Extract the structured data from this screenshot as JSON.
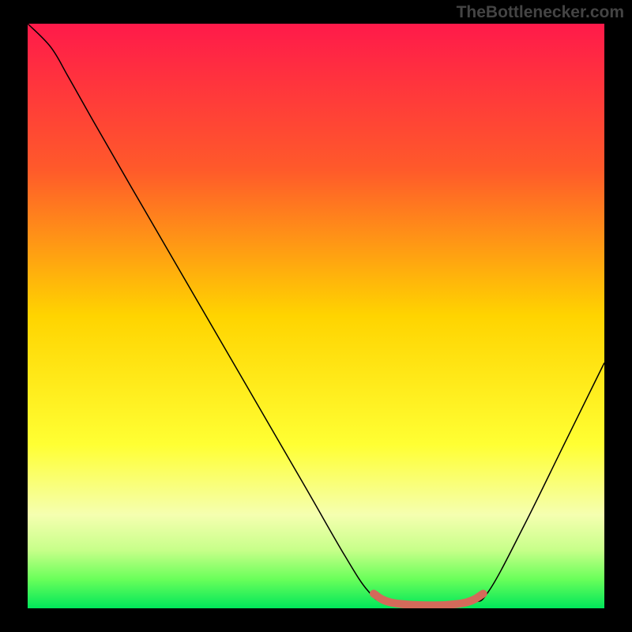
{
  "watermark": "TheBottlenecker.com",
  "chart_data": {
    "type": "line",
    "title": "",
    "xlabel": "",
    "ylabel": "",
    "xlim": [
      0,
      100
    ],
    "ylim": [
      0,
      100
    ],
    "grid": false,
    "gradient_stops": [
      {
        "offset": 0,
        "color": "#ff1a4a"
      },
      {
        "offset": 25,
        "color": "#ff5a2a"
      },
      {
        "offset": 50,
        "color": "#ffd400"
      },
      {
        "offset": 72,
        "color": "#ffff33"
      },
      {
        "offset": 84,
        "color": "#f5ffb0"
      },
      {
        "offset": 90,
        "color": "#c8ff8a"
      },
      {
        "offset": 95,
        "color": "#6aff5a"
      },
      {
        "offset": 100,
        "color": "#00e65a"
      }
    ],
    "series": [
      {
        "name": "bottleneck-curve",
        "color": "#000000",
        "points": [
          {
            "x": 0,
            "y": 100
          },
          {
            "x": 4,
            "y": 96
          },
          {
            "x": 7,
            "y": 91
          },
          {
            "x": 11,
            "y": 84
          },
          {
            "x": 18,
            "y": 72
          },
          {
            "x": 28,
            "y": 55
          },
          {
            "x": 38,
            "y": 38
          },
          {
            "x": 48,
            "y": 21
          },
          {
            "x": 55,
            "y": 9
          },
          {
            "x": 59,
            "y": 3
          },
          {
            "x": 62,
            "y": 1
          },
          {
            "x": 70,
            "y": 0.5
          },
          {
            "x": 77,
            "y": 1
          },
          {
            "x": 80,
            "y": 3
          },
          {
            "x": 86,
            "y": 14
          },
          {
            "x": 93,
            "y": 28
          },
          {
            "x": 100,
            "y": 42
          }
        ]
      },
      {
        "name": "highlight-segment",
        "color": "#d46a5a",
        "stroke_width": 10,
        "points": [
          {
            "x": 60,
            "y": 2.5
          },
          {
            "x": 63,
            "y": 1
          },
          {
            "x": 70,
            "y": 0.5
          },
          {
            "x": 76,
            "y": 1
          },
          {
            "x": 79,
            "y": 2.5
          }
        ]
      }
    ]
  }
}
